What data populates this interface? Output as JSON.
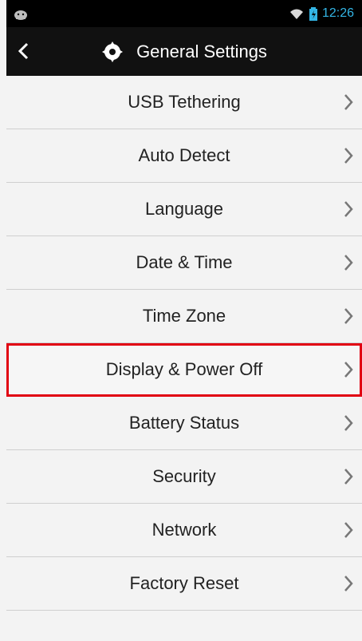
{
  "status": {
    "time": "12:26"
  },
  "header": {
    "title": "General Settings"
  },
  "items": [
    {
      "label": "USB Tethering"
    },
    {
      "label": "Auto Detect"
    },
    {
      "label": "Language"
    },
    {
      "label": "Date & Time"
    },
    {
      "label": "Time Zone"
    },
    {
      "label": "Display & Power Off",
      "highlighted": true
    },
    {
      "label": "Battery Status"
    },
    {
      "label": "Security"
    },
    {
      "label": "Network"
    },
    {
      "label": "Factory Reset"
    }
  ],
  "colors": {
    "accent": "#33b5e5",
    "highlight": "#e10012"
  }
}
